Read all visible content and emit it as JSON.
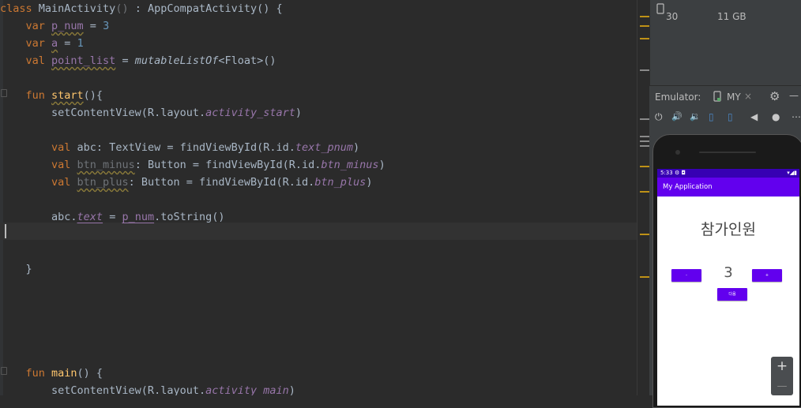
{
  "editor": {
    "lines": [
      [
        [
          "kw",
          "class "
        ],
        [
          "",
          "MainActivity"
        ],
        [
          "dim",
          "() "
        ],
        [
          "",
          ": AppCompatActivity() {"
        ]
      ],
      [
        [
          "",
          "    "
        ],
        [
          "kw",
          "var "
        ],
        [
          "prop wavy",
          "p_num"
        ],
        [
          "",
          " = "
        ],
        [
          "num",
          "3"
        ]
      ],
      [
        [
          "",
          "    "
        ],
        [
          "kw",
          "var "
        ],
        [
          "prop wavy",
          "a"
        ],
        [
          "",
          " = "
        ],
        [
          "num",
          "1"
        ]
      ],
      [
        [
          "",
          "    "
        ],
        [
          "kw",
          "val "
        ],
        [
          "prop wavy",
          "point_list"
        ],
        [
          "",
          " = "
        ],
        [
          "ital",
          "mutableListOf"
        ],
        [
          "",
          "<Float>()"
        ]
      ],
      [
        [
          "",
          ""
        ]
      ],
      [
        [
          "",
          "    "
        ],
        [
          "kw",
          "fun "
        ],
        [
          "fn wavy",
          "start"
        ],
        [
          "",
          "(){"
        ]
      ],
      [
        [
          "",
          "        setContentView(R.layout."
        ],
        [
          "propi",
          "activity_start"
        ],
        [
          "",
          ")"
        ]
      ],
      [
        [
          "",
          ""
        ]
      ],
      [
        [
          "",
          "        "
        ],
        [
          "kw",
          "val "
        ],
        [
          "",
          "abc: TextView = findViewById(R.id."
        ],
        [
          "propi",
          "text_pnum"
        ],
        [
          "",
          ")"
        ]
      ],
      [
        [
          "",
          "        "
        ],
        [
          "kw",
          "val "
        ],
        [
          "dim wavy",
          "btn_minus"
        ],
        [
          "",
          ": Button = findViewById(R.id."
        ],
        [
          "propi",
          "btn_minus"
        ],
        [
          "",
          ")"
        ]
      ],
      [
        [
          "",
          "        "
        ],
        [
          "kw",
          "val "
        ],
        [
          "dim wavy",
          "btn_plus"
        ],
        [
          "",
          ": Button = findViewById(R.id."
        ],
        [
          "propi",
          "btn_plus"
        ],
        [
          "",
          ")"
        ]
      ],
      [
        [
          "",
          ""
        ]
      ],
      [
        [
          "",
          "        abc."
        ],
        [
          "propi under",
          "text"
        ],
        [
          "",
          " = "
        ],
        [
          "prop under",
          "p_num"
        ],
        [
          "",
          ".toString()"
        ]
      ],
      [
        [
          "",
          ""
        ]
      ],
      [
        [
          "",
          ""
        ]
      ],
      [
        [
          "",
          "    }"
        ]
      ],
      [
        [
          "",
          ""
        ]
      ],
      [
        [
          "",
          ""
        ]
      ],
      [
        [
          "",
          ""
        ]
      ],
      [
        [
          "",
          ""
        ]
      ],
      [
        [
          "",
          ""
        ]
      ],
      [
        [
          "",
          "    "
        ],
        [
          "kw",
          "fun "
        ],
        [
          "fn",
          "main"
        ],
        [
          "",
          "() {"
        ]
      ],
      [
        [
          "",
          "        setContentView(R.layout."
        ],
        [
          "propi",
          "activity_main"
        ],
        [
          "",
          ")"
        ]
      ]
    ]
  },
  "device_panel": {
    "api_level": "30",
    "storage": "11 GB"
  },
  "emulator": {
    "label": "Emulator:",
    "tab_label": "MY",
    "close_glyph": "×",
    "settings_glyph": "⚙",
    "minimize_glyph": "—",
    "controls": [
      "⏻",
      "🔊",
      "🔉",
      "▯",
      "▯",
      "◀",
      "●",
      "⋯"
    ]
  },
  "app": {
    "status_time": "5:33",
    "status_icons": "⚙ ◘",
    "status_right": "▾◢▮",
    "title": "My Application",
    "heading": "참가인원",
    "count": "3",
    "minus_label": "-",
    "plus_label": "+",
    "next_label": "다음"
  },
  "zoom": {
    "zoom_in": "+",
    "zoom_out": "—"
  }
}
